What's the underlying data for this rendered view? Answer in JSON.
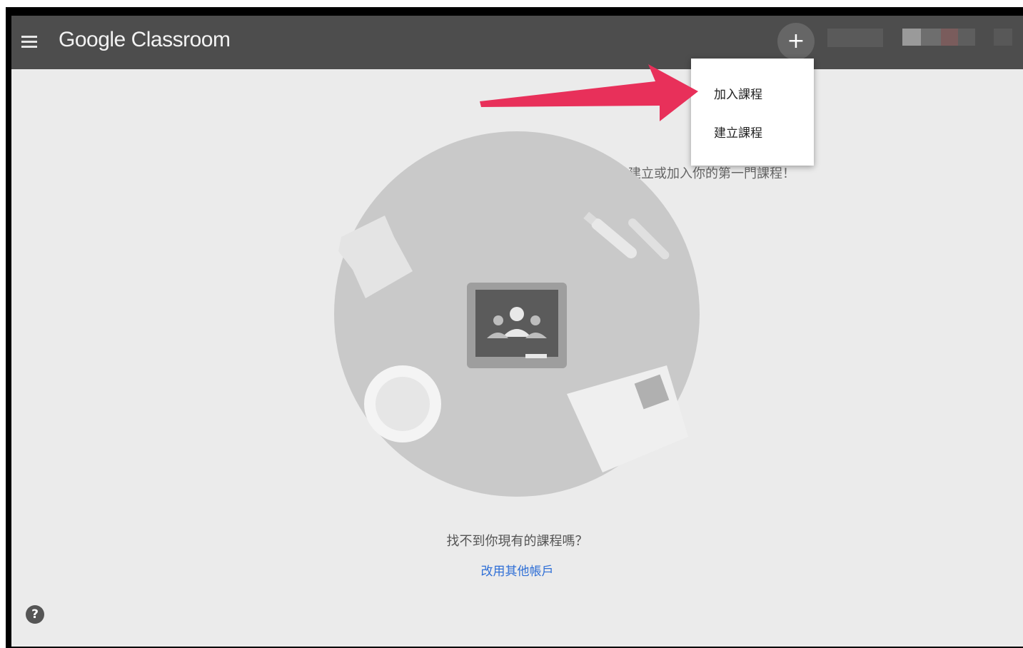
{
  "header": {
    "app_title": "Google Classroom",
    "add_button_symbol": "+"
  },
  "menu": {
    "items": [
      {
        "label": "加入課程"
      },
      {
        "label": "建立課程"
      }
    ]
  },
  "main": {
    "hint": "建立或加入你的第一門課程！",
    "cant_find": "找不到你現有的課程嗎？",
    "switch_account": "改用其他帳戶"
  },
  "help": {
    "symbol": "?"
  },
  "icons": {
    "menu": "hamburger-menu-icon",
    "add": "plus-icon",
    "help": "help-circle-icon",
    "classroom": "classroom-board-icon",
    "annotation": "red-arrow-annotation"
  },
  "colors": {
    "topbar": "#4d4d4d",
    "background": "#ebebeb",
    "link": "#2f6fd6",
    "annotation_arrow": "#e8305a"
  }
}
